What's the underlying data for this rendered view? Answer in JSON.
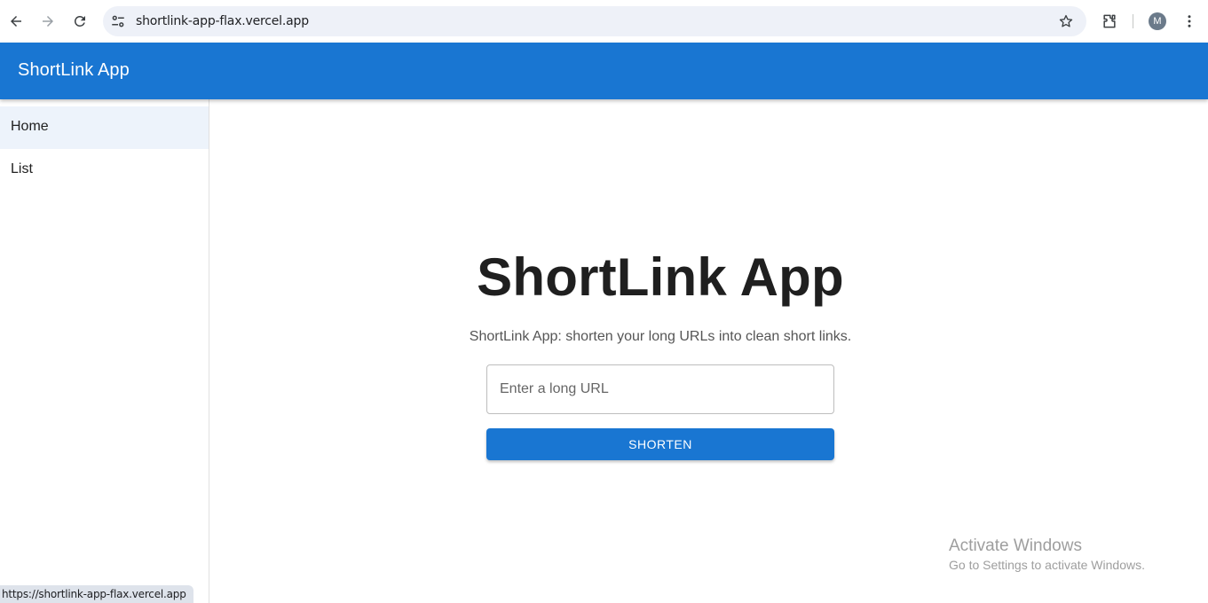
{
  "browser": {
    "url": "shortlink-app-flax.vercel.app",
    "profile_initial": "M",
    "icons": [
      "back-icon",
      "forward-icon",
      "reload-icon",
      "site-settings-icon",
      "bookmark-star-icon",
      "extensions-icon",
      "kebab-menu-icon"
    ]
  },
  "app_bar": {
    "title": "ShortLink App",
    "color": "#1976d2"
  },
  "sidebar": {
    "items": [
      {
        "label": "Home",
        "active": true
      },
      {
        "label": "List",
        "active": false
      }
    ]
  },
  "main": {
    "title": "ShortLink App",
    "subtitle": "ShortLink App: shorten your long URLs into clean short links.",
    "input_placeholder": "Enter a long URL",
    "input_value": "",
    "button_label": "SHORTEN"
  },
  "watermark": {
    "title": "Activate Windows",
    "subtitle": "Go to Settings to activate Windows."
  },
  "status_bar": {
    "link": "https://shortlink-app-flax.vercel.app"
  }
}
